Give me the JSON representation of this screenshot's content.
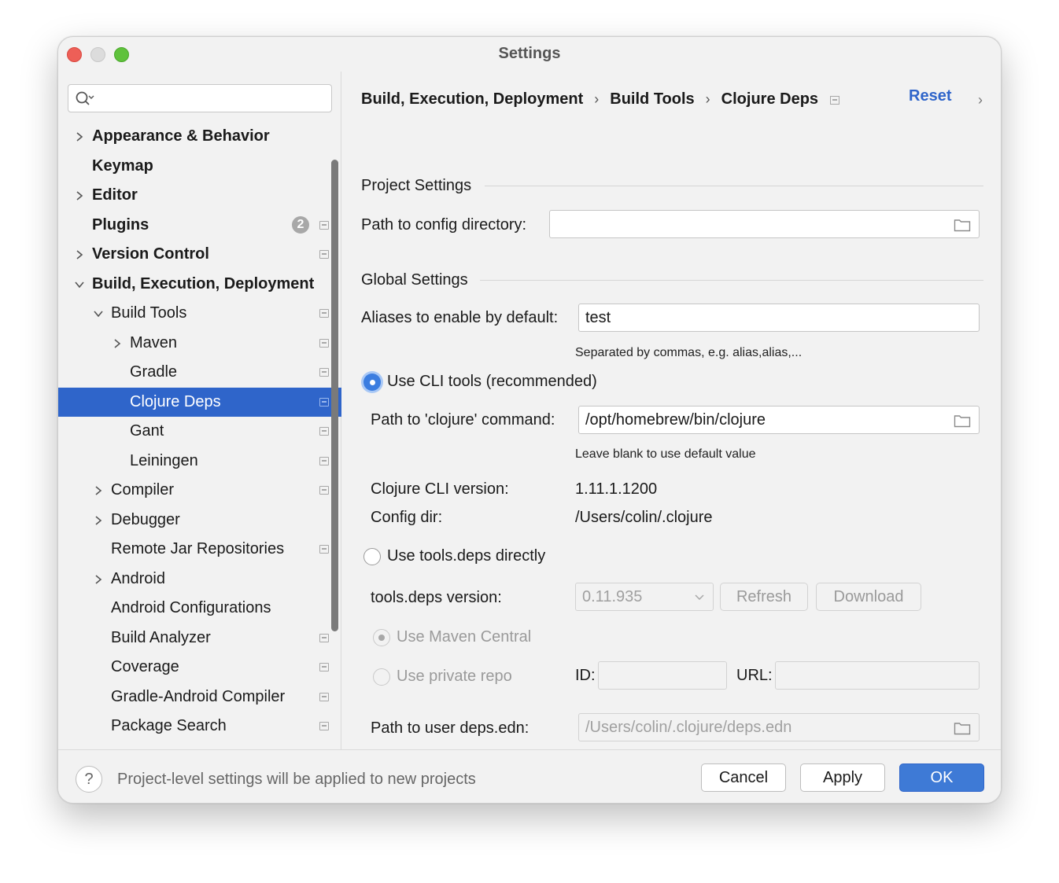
{
  "window": {
    "title": "Settings"
  },
  "search": {
    "placeholder": ""
  },
  "sidebar": {
    "items": [
      {
        "label": "Appearance & Behavior"
      },
      {
        "label": "Keymap"
      },
      {
        "label": "Editor"
      },
      {
        "label": "Plugins",
        "badge": "2"
      },
      {
        "label": "Version Control"
      },
      {
        "label": "Build, Execution, Deployment"
      },
      {
        "label": "Build Tools"
      },
      {
        "label": "Maven"
      },
      {
        "label": "Gradle"
      },
      {
        "label": "Clojure Deps"
      },
      {
        "label": "Gant"
      },
      {
        "label": "Leiningen"
      },
      {
        "label": "Compiler"
      },
      {
        "label": "Debugger"
      },
      {
        "label": "Remote Jar Repositories"
      },
      {
        "label": "Android"
      },
      {
        "label": "Android Configurations"
      },
      {
        "label": "Build Analyzer"
      },
      {
        "label": "Coverage"
      },
      {
        "label": "Gradle-Android Compiler"
      },
      {
        "label": "Package Search"
      }
    ]
  },
  "breadcrumb": {
    "items": [
      "Build, Execution, Deployment",
      "Build Tools",
      "Clojure Deps"
    ],
    "separator": "›"
  },
  "header": {
    "reset_label": "Reset",
    "forward_glyph": "›"
  },
  "project_settings": {
    "title": "Project Settings",
    "config_dir_label": "Path to config directory:",
    "config_dir_value": ""
  },
  "global_settings": {
    "title": "Global Settings",
    "aliases_label": "Aliases to enable by default:",
    "aliases_value": "test",
    "aliases_hint": "Separated by commas, e.g. alias,alias,...",
    "use_cli_label": "Use CLI tools (recommended)",
    "clojure_cmd_label": "Path to 'clojure' command:",
    "clojure_cmd_value": "/opt/homebrew/bin/clojure",
    "clojure_cmd_hint": "Leave blank to use default value",
    "cli_version_label": "Clojure CLI version:",
    "cli_version_value": "1.11.1.1200",
    "config_dir_label": "Config dir:",
    "config_dir_value": "/Users/colin/.clojure",
    "use_tools_deps_label": "Use tools.deps directly",
    "tools_deps_version_label": "tools.deps version:",
    "tools_deps_version_value": "0.11.935",
    "refresh_label": "Refresh",
    "download_label": "Download",
    "maven_central_label": "Use Maven Central",
    "private_repo_label": "Use private repo",
    "id_label": "ID:",
    "url_label": "URL:",
    "user_deps_label": "Path to user deps.edn:",
    "user_deps_value": "/Users/colin/.clojure/deps.edn"
  },
  "footer": {
    "help_glyph": "?",
    "note": "Project-level settings will be applied to new projects",
    "cancel_label": "Cancel",
    "apply_label": "Apply",
    "ok_label": "OK"
  },
  "colors": {
    "accent": "#2f65ca",
    "primary_button": "#3e7ad6",
    "radio_on": "#3b7de0"
  }
}
